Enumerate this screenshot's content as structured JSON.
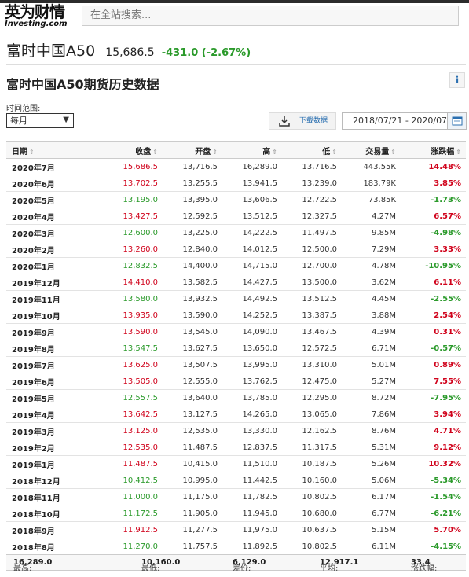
{
  "header": {
    "logo_cn": "英为财情",
    "logo_en": "Investing.com",
    "search_placeholder": "在全站搜索..."
  },
  "quote": {
    "name": "富时中国A50",
    "price": "15,686.5",
    "change": "-431.0 (-2.67%)",
    "change_color": "#2b9a2b"
  },
  "section": {
    "title": "富时中国A50期货历史数据",
    "info_icon": "i"
  },
  "controls": {
    "range_label": "时间范围:",
    "period_selected": "每月",
    "download_label": "下载数据",
    "date_range": "2018/07/21 - 2020/07/10"
  },
  "colors": {
    "up": "#d0021b",
    "down": "#2b9a2b"
  },
  "table": {
    "headers": [
      "日期",
      "收盘",
      "开盘",
      "高",
      "低",
      "交易量",
      "涨跌幅"
    ],
    "rows": [
      {
        "date": "2020年7月",
        "close": "15,686.5",
        "open": "13,716.5",
        "high": "16,289.0",
        "low": "13,716.5",
        "vol": "443.55K",
        "pct": "14.48%",
        "dir": "up"
      },
      {
        "date": "2020年6月",
        "close": "13,702.5",
        "open": "13,255.5",
        "high": "13,941.5",
        "low": "13,239.0",
        "vol": "183.79K",
        "pct": "3.85%",
        "dir": "up"
      },
      {
        "date": "2020年5月",
        "close": "13,195.0",
        "open": "13,395.0",
        "high": "13,606.5",
        "low": "12,722.5",
        "vol": "73.85K",
        "pct": "-1.73%",
        "dir": "down"
      },
      {
        "date": "2020年4月",
        "close": "13,427.5",
        "open": "12,592.5",
        "high": "13,512.5",
        "low": "12,327.5",
        "vol": "4.27M",
        "pct": "6.57%",
        "dir": "up"
      },
      {
        "date": "2020年3月",
        "close": "12,600.0",
        "open": "13,225.0",
        "high": "14,222.5",
        "low": "11,497.5",
        "vol": "9.85M",
        "pct": "-4.98%",
        "dir": "down"
      },
      {
        "date": "2020年2月",
        "close": "13,260.0",
        "open": "12,840.0",
        "high": "14,012.5",
        "low": "12,500.0",
        "vol": "7.29M",
        "pct": "3.33%",
        "dir": "up"
      },
      {
        "date": "2020年1月",
        "close": "12,832.5",
        "open": "14,400.0",
        "high": "14,715.0",
        "low": "12,700.0",
        "vol": "4.78M",
        "pct": "-10.95%",
        "dir": "down"
      },
      {
        "date": "2019年12月",
        "close": "14,410.0",
        "open": "13,582.5",
        "high": "14,427.5",
        "low": "13,500.0",
        "vol": "3.62M",
        "pct": "6.11%",
        "dir": "up"
      },
      {
        "date": "2019年11月",
        "close": "13,580.0",
        "open": "13,932.5",
        "high": "14,492.5",
        "low": "13,512.5",
        "vol": "4.45M",
        "pct": "-2.55%",
        "dir": "down"
      },
      {
        "date": "2019年10月",
        "close": "13,935.0",
        "open": "13,590.0",
        "high": "14,252.5",
        "low": "13,387.5",
        "vol": "3.88M",
        "pct": "2.54%",
        "dir": "up"
      },
      {
        "date": "2019年9月",
        "close": "13,590.0",
        "open": "13,545.0",
        "high": "14,090.0",
        "low": "13,467.5",
        "vol": "4.39M",
        "pct": "0.31%",
        "dir": "up"
      },
      {
        "date": "2019年8月",
        "close": "13,547.5",
        "open": "13,627.5",
        "high": "13,650.0",
        "low": "12,572.5",
        "vol": "6.71M",
        "pct": "-0.57%",
        "dir": "down"
      },
      {
        "date": "2019年7月",
        "close": "13,625.0",
        "open": "13,507.5",
        "high": "13,995.0",
        "low": "13,310.0",
        "vol": "5.01M",
        "pct": "0.89%",
        "dir": "up"
      },
      {
        "date": "2019年6月",
        "close": "13,505.0",
        "open": "12,555.0",
        "high": "13,762.5",
        "low": "12,475.0",
        "vol": "5.27M",
        "pct": "7.55%",
        "dir": "up"
      },
      {
        "date": "2019年5月",
        "close": "12,557.5",
        "open": "13,640.0",
        "high": "13,785.0",
        "low": "12,295.0",
        "vol": "8.72M",
        "pct": "-7.95%",
        "dir": "down"
      },
      {
        "date": "2019年4月",
        "close": "13,642.5",
        "open": "13,127.5",
        "high": "14,265.0",
        "low": "13,065.0",
        "vol": "7.86M",
        "pct": "3.94%",
        "dir": "up"
      },
      {
        "date": "2019年3月",
        "close": "13,125.0",
        "open": "12,535.0",
        "high": "13,330.0",
        "low": "12,162.5",
        "vol": "8.76M",
        "pct": "4.71%",
        "dir": "up"
      },
      {
        "date": "2019年2月",
        "close": "12,535.0",
        "open": "11,487.5",
        "high": "12,837.5",
        "low": "11,317.5",
        "vol": "5.31M",
        "pct": "9.12%",
        "dir": "up"
      },
      {
        "date": "2019年1月",
        "close": "11,487.5",
        "open": "10,415.0",
        "high": "11,510.0",
        "low": "10,187.5",
        "vol": "5.26M",
        "pct": "10.32%",
        "dir": "up"
      },
      {
        "date": "2018年12月",
        "close": "10,412.5",
        "open": "10,995.0",
        "high": "11,442.5",
        "low": "10,160.0",
        "vol": "5.06M",
        "pct": "-5.34%",
        "dir": "down"
      },
      {
        "date": "2018年11月",
        "close": "11,000.0",
        "open": "11,175.0",
        "high": "11,782.5",
        "low": "10,802.5",
        "vol": "6.17M",
        "pct": "-1.54%",
        "dir": "down"
      },
      {
        "date": "2018年10月",
        "close": "11,172.5",
        "open": "11,905.0",
        "high": "11,945.0",
        "low": "10,680.0",
        "vol": "6.77M",
        "pct": "-6.21%",
        "dir": "down"
      },
      {
        "date": "2018年9月",
        "close": "11,912.5",
        "open": "11,277.5",
        "high": "11,975.0",
        "low": "10,637.5",
        "vol": "5.15M",
        "pct": "5.70%",
        "dir": "up"
      },
      {
        "date": "2018年8月",
        "close": "11,270.0",
        "open": "11,757.5",
        "high": "11,892.5",
        "low": "10,802.5",
        "vol": "6.11M",
        "pct": "-4.15%",
        "dir": "down"
      }
    ]
  },
  "summary": {
    "high_label": "最高:",
    "high": "16,289.0",
    "low_label": "最低:",
    "low": "10,160.0",
    "diff_label": "差价:",
    "diff": "6,129.0",
    "avg_label": "平均:",
    "avg": "12,917.1",
    "pct_label": "涨跌幅:",
    "pct": "33.4"
  }
}
